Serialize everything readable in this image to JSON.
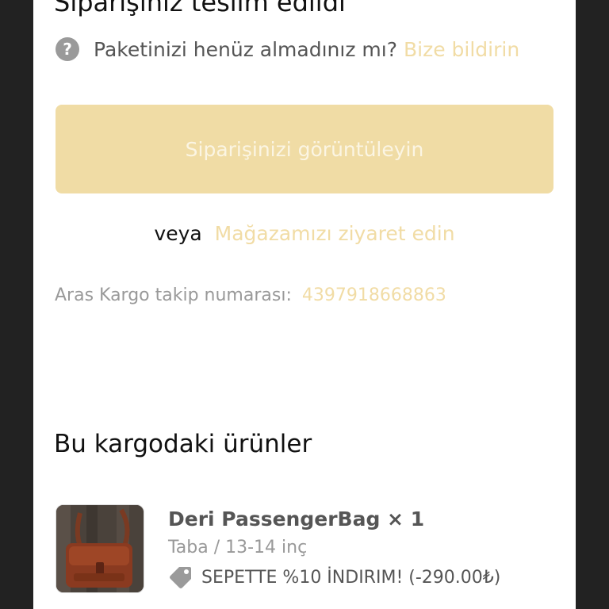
{
  "status": {
    "heading": "Siparişiniz teslim edildi"
  },
  "help": {
    "icon": "question-circle-icon",
    "question": "Paketinizi henüz almadınız mı?",
    "link": "Bize bildirin"
  },
  "actions": {
    "view_order": "Siparişinizi görüntüleyin",
    "or_label": "veya",
    "visit_store": "Mağazamızı ziyaret edin"
  },
  "tracking": {
    "label": "Aras Kargo takip numarası:",
    "number": "4397918668863"
  },
  "shipment": {
    "title": "Bu kargodaki ürünler",
    "items": [
      {
        "name": "Deri PassengerBag × 1",
        "variant": "Taba / 13-14 inç",
        "discount": "SEPETTE %10 İNDIRIM! (-290.00₺)",
        "discount_icon": "price-tag-icon"
      }
    ]
  },
  "colors": {
    "accent": "#f0dca5",
    "page_frame": "#222222",
    "card_bg": "#ffffff"
  }
}
